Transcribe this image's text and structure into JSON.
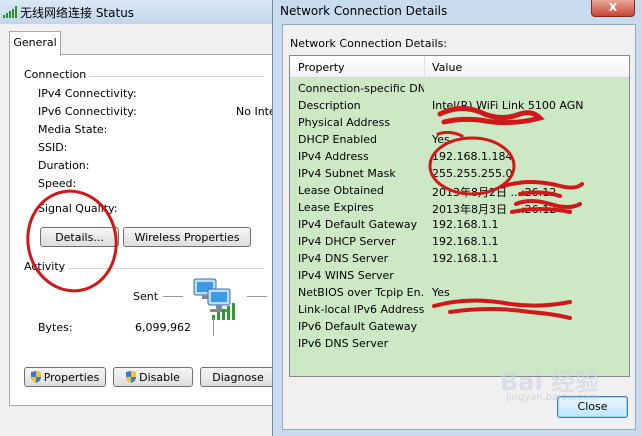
{
  "status_dialog": {
    "title": "无线网络连接 Status",
    "tab": "General",
    "connection_group": "Connection",
    "rows": [
      {
        "label": "IPv4 Connectivity:",
        "value": ""
      },
      {
        "label": "IPv6 Connectivity:",
        "value": "No Inte"
      },
      {
        "label": "Media State:",
        "value": ""
      },
      {
        "label": "SSID:",
        "value": ""
      },
      {
        "label": "Duration:",
        "value": ""
      },
      {
        "label": "Speed:",
        "value": ""
      },
      {
        "label": "Signal Quality:",
        "value": ""
      }
    ],
    "details_button": "Details...",
    "wireless_properties_button": "Wireless Properties",
    "activity_group": "Activity",
    "sent_label": "Sent",
    "bytes_label": "Bytes:",
    "bytes_sent": "6,099,962",
    "properties_button": "Properties",
    "disable_button": "Disable",
    "diagnose_button": "Diagnose"
  },
  "details_dialog": {
    "title": "Network Connection Details",
    "heading": "Network Connection Details:",
    "columns": {
      "property": "Property",
      "value": "Value"
    },
    "rows": [
      {
        "property": "Connection-specific DN...",
        "value": ""
      },
      {
        "property": "Description",
        "value": "Intel(R) WiFi Link 5100 AGN"
      },
      {
        "property": "Physical Address",
        "value": ""
      },
      {
        "property": "DHCP Enabled",
        "value": "Yes"
      },
      {
        "property": "IPv4 Address",
        "value": "192.168.1.184"
      },
      {
        "property": "IPv4 Subnet Mask",
        "value": "255.255.255.0"
      },
      {
        "property": "Lease Obtained",
        "value": "2013年8月2日 ...:26:12"
      },
      {
        "property": "Lease Expires",
        "value": "2013年8月3日 ...:26:12"
      },
      {
        "property": "IPv4 Default Gateway",
        "value": "192.168.1.1"
      },
      {
        "property": "IPv4 DHCP Server",
        "value": "192.168.1.1"
      },
      {
        "property": "IPv4 DNS Server",
        "value": "192.168.1.1"
      },
      {
        "property": "IPv4 WINS Server",
        "value": ""
      },
      {
        "property": "NetBIOS over Tcpip En...",
        "value": "Yes"
      },
      {
        "property": "Link-local IPv6 Address",
        "value": ""
      },
      {
        "property": "IPv6 Default Gateway",
        "value": ""
      },
      {
        "property": "IPv6 DNS Server",
        "value": ""
      }
    ],
    "close_button": "Close",
    "close_x": "X"
  },
  "watermark": {
    "text": "Bai 经验",
    "sub": "jingyan.baidu.com"
  },
  "colors": {
    "list_bg": "#cde8c5",
    "annotation_red": "#d01818",
    "titlebar": "#c9dbef"
  },
  "icons": [
    "signal-bars-icon",
    "network-computers-icon",
    "shield-icon",
    "close-icon"
  ]
}
